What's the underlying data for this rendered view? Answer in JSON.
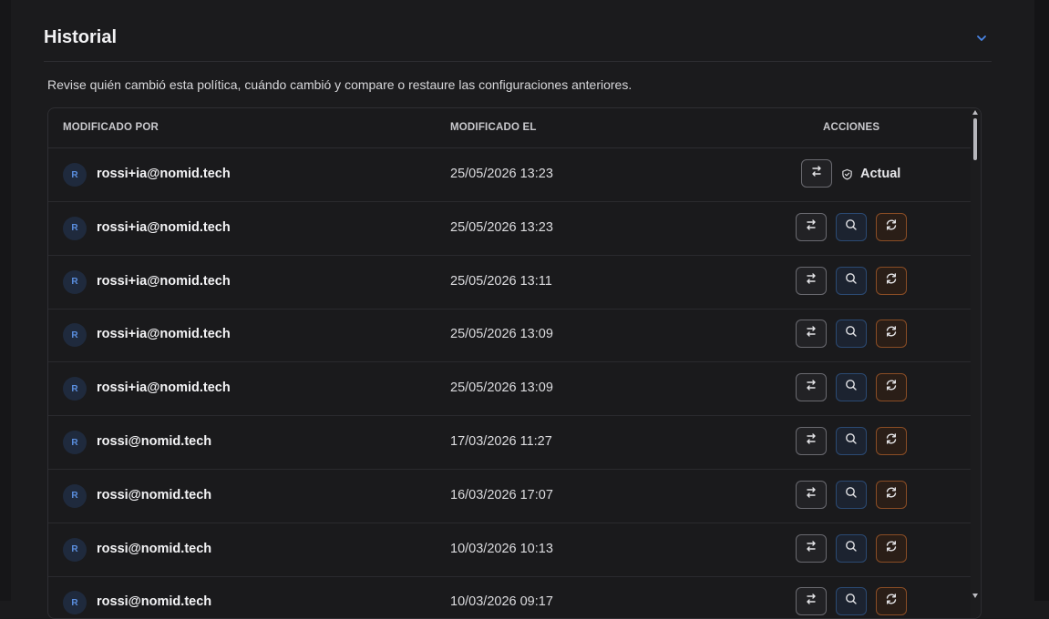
{
  "section": {
    "title": "Historial",
    "description": "Revise quién cambió esta política, cuándo cambió y compare o restaure las configuraciones anteriores."
  },
  "table": {
    "columns": [
      "MODIFICADO POR",
      "MODIFICADO EL",
      "ACCIONES"
    ],
    "current_label": "Actual",
    "rows": [
      {
        "avatar": "R",
        "user": "rossi+ia@nomid.tech",
        "date": "25/05/2026 13:23",
        "current": true
      },
      {
        "avatar": "R",
        "user": "rossi+ia@nomid.tech",
        "date": "25/05/2026 13:23",
        "current": false
      },
      {
        "avatar": "R",
        "user": "rossi+ia@nomid.tech",
        "date": "25/05/2026 13:11",
        "current": false
      },
      {
        "avatar": "R",
        "user": "rossi+ia@nomid.tech",
        "date": "25/05/2026 13:09",
        "current": false
      },
      {
        "avatar": "R",
        "user": "rossi+ia@nomid.tech",
        "date": "25/05/2026 13:09",
        "current": false
      },
      {
        "avatar": "R",
        "user": "rossi@nomid.tech",
        "date": "17/03/2026 11:27",
        "current": false
      },
      {
        "avatar": "R",
        "user": "rossi@nomid.tech",
        "date": "16/03/2026 17:07",
        "current": false
      },
      {
        "avatar": "R",
        "user": "rossi@nomid.tech",
        "date": "10/03/2026 10:13",
        "current": false
      },
      {
        "avatar": "R",
        "user": "rossi@nomid.tech",
        "date": "10/03/2026 09:17",
        "current": false
      }
    ]
  },
  "icons": {
    "collapse": "chevron-down-icon",
    "compare": "arrows-swap-icon",
    "view": "search-icon",
    "restore": "refresh-icon",
    "current": "shield-check-icon"
  },
  "colors": {
    "accent_blue": "#4a86e8",
    "view_border": "#2b4a73",
    "restore_border": "#8a4d25",
    "compare_border": "#6a6a70"
  }
}
